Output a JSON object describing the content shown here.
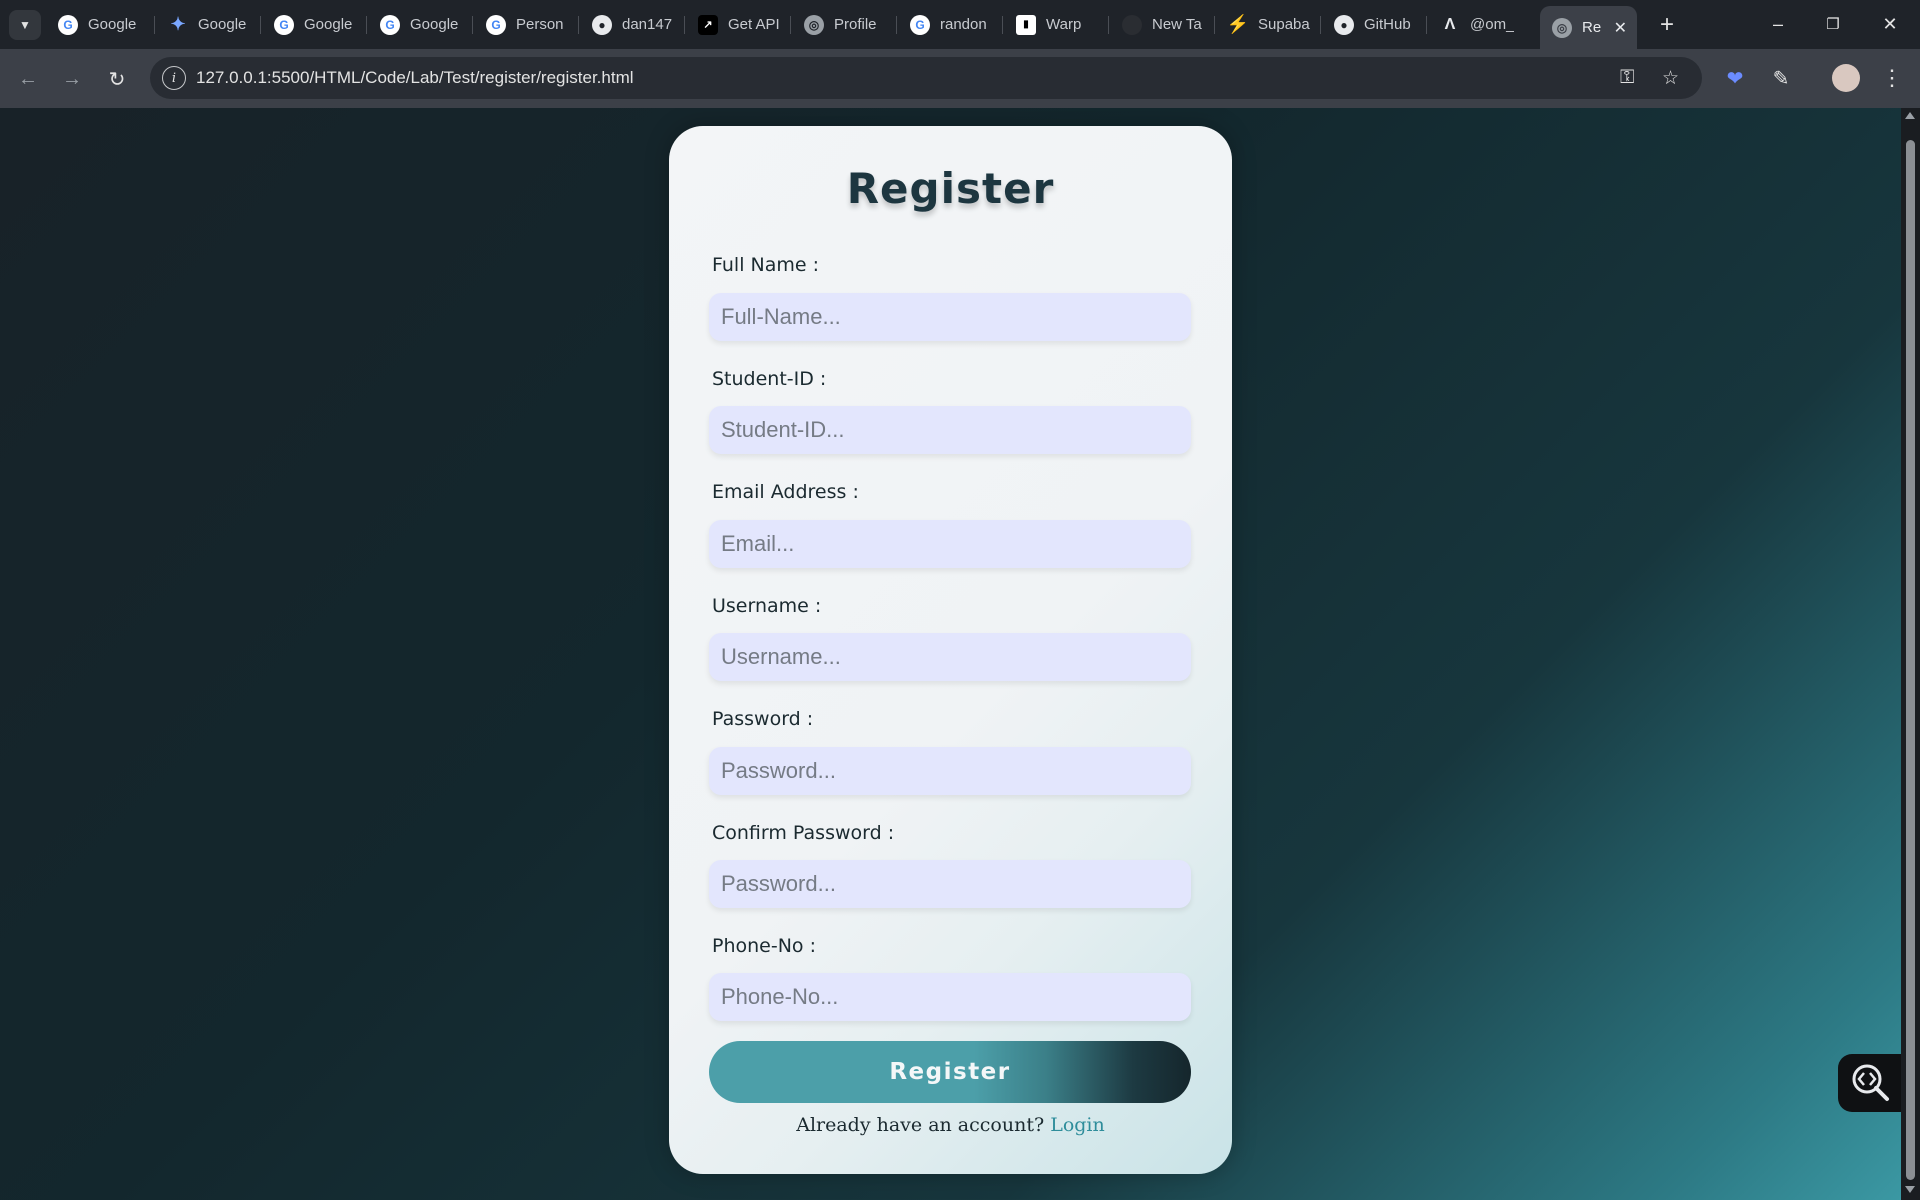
{
  "browser": {
    "tabs": [
      {
        "label": "Google",
        "icon": "google-icon"
      },
      {
        "label": "Google",
        "icon": "gemini-icon"
      },
      {
        "label": "Google",
        "icon": "google-icon"
      },
      {
        "label": "Google",
        "icon": "google-icon"
      },
      {
        "label": "Person",
        "icon": "google-icon"
      },
      {
        "label": "dan147",
        "icon": "github-icon"
      },
      {
        "label": "Get API",
        "icon": "api-icon"
      },
      {
        "label": "Profile",
        "icon": "globe-icon"
      },
      {
        "label": "randon",
        "icon": "google-icon"
      },
      {
        "label": "Warp",
        "icon": "warp-icon"
      },
      {
        "label": "New Ta",
        "icon": "blank-icon"
      },
      {
        "label": "Supaba",
        "icon": "supabase-icon"
      },
      {
        "label": "GitHub",
        "icon": "github-icon"
      },
      {
        "label": "@om_",
        "icon": "triangle-icon"
      },
      {
        "label": "Re",
        "icon": "globe-icon",
        "active": true
      }
    ],
    "url": "127.0.0.1:5500/HTML/Code/Lab/Test/register/register.html"
  },
  "form": {
    "title": "Register",
    "fields": [
      {
        "label": "Full Name :",
        "placeholder": "Full-Name..."
      },
      {
        "label": "Student-ID :",
        "placeholder": "Student-ID..."
      },
      {
        "label": "Email Address :",
        "placeholder": "Email..."
      },
      {
        "label": "Username :",
        "placeholder": "Username..."
      },
      {
        "label": "Password :",
        "placeholder": "Password..."
      },
      {
        "label": "Confirm Password :",
        "placeholder": "Password..."
      },
      {
        "label": "Phone-No :",
        "placeholder": "Phone-No..."
      }
    ],
    "submit_label": "Register",
    "footer_text": "Already have an account?",
    "login_label": "Login"
  },
  "colors": {
    "accent": "#4c9fa9",
    "input_bg": "#e3e6fd",
    "link": "#2e8d9b"
  }
}
